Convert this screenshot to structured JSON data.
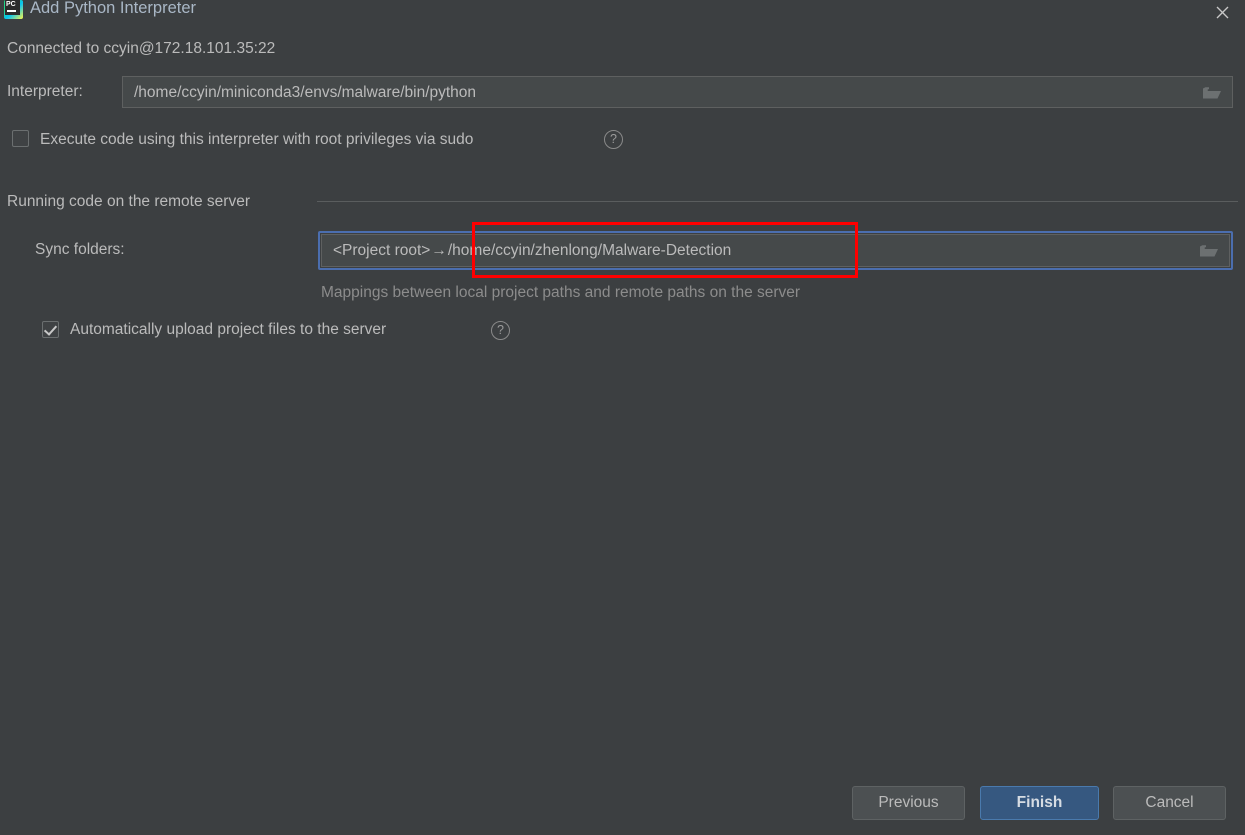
{
  "window": {
    "title": "Add Python Interpreter",
    "icon": "pycharm-logo-icon",
    "close_icon": "close-icon"
  },
  "connection": {
    "status_text": "Connected to ccyin@172.18.101.35:22"
  },
  "interpreter": {
    "label": "Interpreter:",
    "value": "/home/ccyin/miniconda3/envs/malware/bin/python",
    "browse_icon": "folder-icon"
  },
  "sudo": {
    "label": "Execute code using this interpreter with root privileges via sudo",
    "checked": false,
    "help_icon": "question-mark-icon",
    "help_glyph": "?"
  },
  "remote_group": {
    "title": "Running code on the remote server"
  },
  "sync_folders": {
    "label": "Sync folders:",
    "local": "<Project root>",
    "arrow": "→",
    "remote": "/home/ccyin/zhenlong/Malware-Detection",
    "hint": "Mappings between local project paths and remote paths on the server",
    "browse_icon": "folder-icon",
    "focused": true
  },
  "auto_upload": {
    "label": "Automatically upload project files to the server",
    "checked": true,
    "help_icon": "question-mark-icon",
    "help_glyph": "?"
  },
  "annotation": {
    "shape": "rectangle",
    "color": "#fe0000",
    "targets": "sync-folders-remote-path"
  },
  "buttons": {
    "previous": "Previous",
    "finish": "Finish",
    "cancel": "Cancel"
  },
  "colors": {
    "background": "#3c3f41",
    "field_background": "#45494a",
    "accent_blue": "#365880",
    "focus_blue": "#4b6eaf",
    "annotation_red": "#fe0000",
    "text": "#bbbbbb",
    "text_dim": "#8c8c8c"
  }
}
